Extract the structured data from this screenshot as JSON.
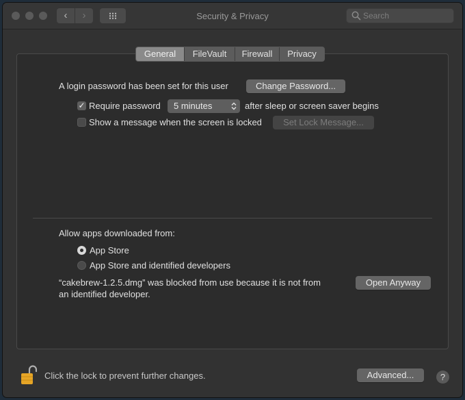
{
  "window": {
    "title": "Security & Privacy",
    "nav_back_glyph": "‹",
    "nav_forward_glyph": "›"
  },
  "search": {
    "placeholder": "Search"
  },
  "tabs": [
    {
      "label": "General",
      "active": true
    },
    {
      "label": "FileVault",
      "active": false
    },
    {
      "label": "Firewall",
      "active": false
    },
    {
      "label": "Privacy",
      "active": false
    }
  ],
  "general": {
    "login_password_text": "A login password has been set for this user",
    "change_password_label": "Change Password...",
    "require_password": {
      "checked": true,
      "check_glyph": "✓",
      "label": "Require password",
      "selected_option": "5 minutes",
      "suffix": "after sleep or screen saver begins"
    },
    "show_message": {
      "checked": false,
      "label": "Show a message when the screen is locked",
      "button_label": "Set Lock Message..."
    }
  },
  "downloads": {
    "heading": "Allow apps downloaded from:",
    "options": [
      {
        "label": "App Store",
        "selected": true
      },
      {
        "label": "App Store and identified developers",
        "selected": false
      }
    ],
    "blocked_message_line1": "“cakebrew-1.2.5.dmg” was blocked from use because it is not from",
    "blocked_message_line2": "an identified developer.",
    "open_anyway_label": "Open Anyway"
  },
  "footer": {
    "lock_text": "Click the lock to prevent further changes.",
    "advanced_label": "Advanced...",
    "help_glyph": "?"
  },
  "icons": {
    "lock": "lock-open-icon",
    "search": "search-icon",
    "grid": "grid-icon",
    "help": "help-icon"
  },
  "colors": {
    "window_bg": "#323232",
    "panel_bg": "#2c2c2c",
    "lock_gold": "#e6a526"
  }
}
